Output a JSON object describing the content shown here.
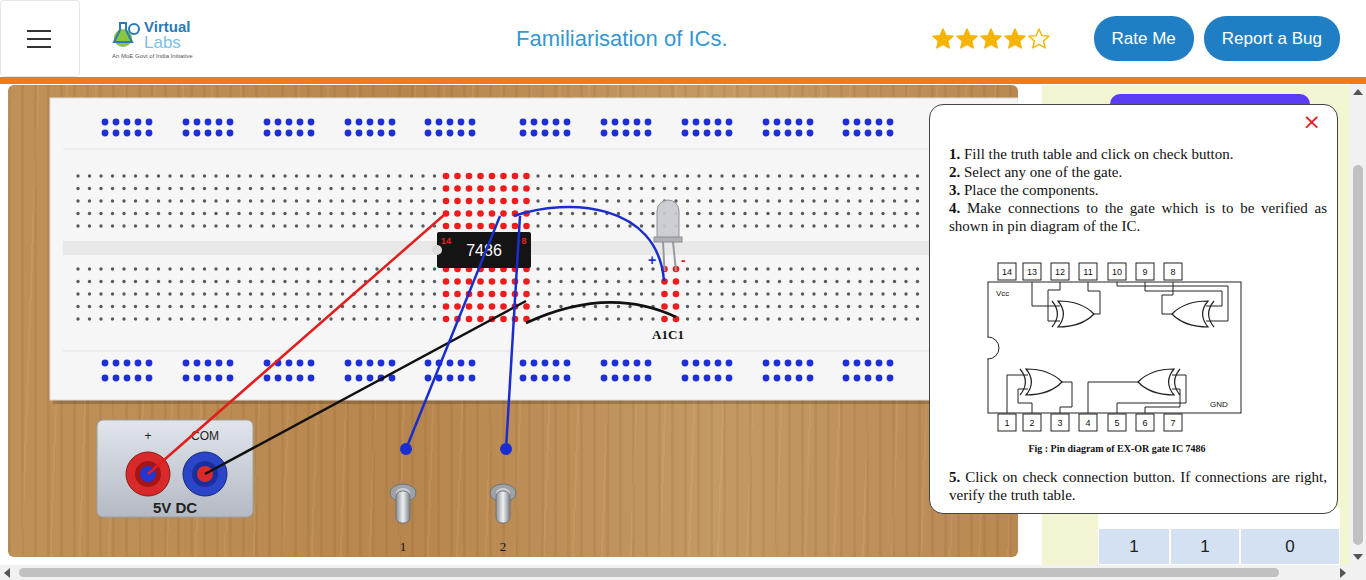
{
  "header": {
    "logo": {
      "name": "Virtual",
      "name_second": "Labs",
      "tagline": "An MoE Govt of India Initiative"
    },
    "title": "Familiarisation of ICs.",
    "rating": {
      "stars": 4,
      "total": 5
    },
    "buttons": [
      {
        "label": "Rate Me"
      },
      {
        "label": "Report a Bug"
      }
    ]
  },
  "breadboard": {
    "ic": {
      "label": "7486",
      "pin_first": "14",
      "pin_last": "8"
    },
    "led": {
      "label": "A1C1",
      "plus": "+",
      "minus": "-"
    }
  },
  "power_supply": {
    "plus": "+",
    "common": "COM",
    "label": "5V DC"
  },
  "switches": [
    {
      "label": "1",
      "on": false
    },
    {
      "label": "2",
      "on": false
    }
  ],
  "instructions": {
    "close": "×",
    "steps": [
      {
        "number": "1.",
        "text": "Fill the truth table and click on check button."
      },
      {
        "number": "2.",
        "text": "Select any one of the gate."
      },
      {
        "number": "3.",
        "text": "Place the components."
      },
      {
        "number": "4.",
        "text": "Make connections to the gate which is to be verified as shown in pin diagram of the IC."
      },
      {
        "number": "5.",
        "text": "Click on check connection button. If connections are right, verify the truth table."
      }
    ],
    "figure": {
      "top_pins": [
        "14",
        "13",
        "12",
        "11",
        "10",
        "9",
        "8"
      ],
      "bottom_pins": [
        "1",
        "2",
        "3",
        "4",
        "5",
        "6",
        "7"
      ],
      "vcc": "Vcc",
      "gnd": "GND",
      "caption": "Fig : Pin diagram of EX-OR gate IC 7486"
    }
  },
  "truth_table": {
    "rows": [
      [
        "1",
        "1",
        "0"
      ]
    ]
  }
}
